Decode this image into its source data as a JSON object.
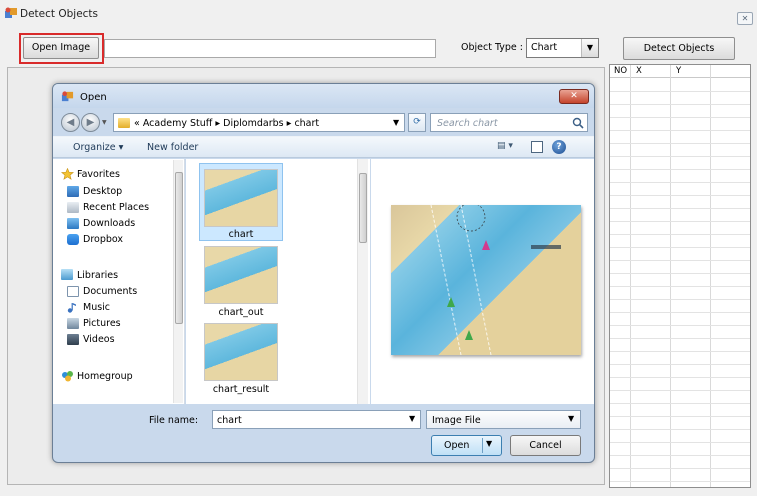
{
  "app": {
    "title": "Detect Objects",
    "close_glyph": "✕",
    "open_image_label": "Open Image",
    "path_value": "",
    "object_type_label": "Object Type :",
    "object_type_value": "Chart",
    "detect_label": "Detect Objects",
    "grid_columns": [
      "NO",
      "X",
      "Y"
    ]
  },
  "dialog": {
    "title": "Open",
    "close_glyph": "✕",
    "address": {
      "prefix": "«",
      "crumbs": [
        "Academy Stuff",
        "Diplomdarbs",
        "chart"
      ],
      "separator": "▸"
    },
    "search_placeholder": "Search chart",
    "toolbar": {
      "organize": "Organize ▾",
      "new_folder": "New folder",
      "help": "?"
    },
    "nav": {
      "favorites": "Favorites",
      "favorites_items": [
        "Desktop",
        "Recent Places",
        "Downloads",
        "Dropbox"
      ],
      "libraries": "Libraries",
      "libraries_items": [
        "Documents",
        "Music",
        "Pictures",
        "Videos"
      ],
      "homegroup": "Homegroup"
    },
    "files": [
      "chart",
      "chart_out",
      "chart_result"
    ],
    "selected_file": "chart",
    "filename_label": "File name:",
    "filename_value": "chart",
    "filetype_value": "Image File",
    "open_label": "Open",
    "cancel_label": "Cancel"
  },
  "colors": {
    "highlight": "#d92b2b",
    "dialog_frame": "#c9d9ec",
    "selection": "#cce8ff"
  },
  "icons": [
    "app-icon",
    "folder-icon",
    "search-icon",
    "help-icon",
    "star-icon",
    "desktop-icon",
    "recent-icon",
    "downloads-icon",
    "dropbox-icon",
    "library-icon",
    "documents-icon",
    "music-icon",
    "pictures-icon",
    "videos-icon",
    "homegroup-icon"
  ]
}
